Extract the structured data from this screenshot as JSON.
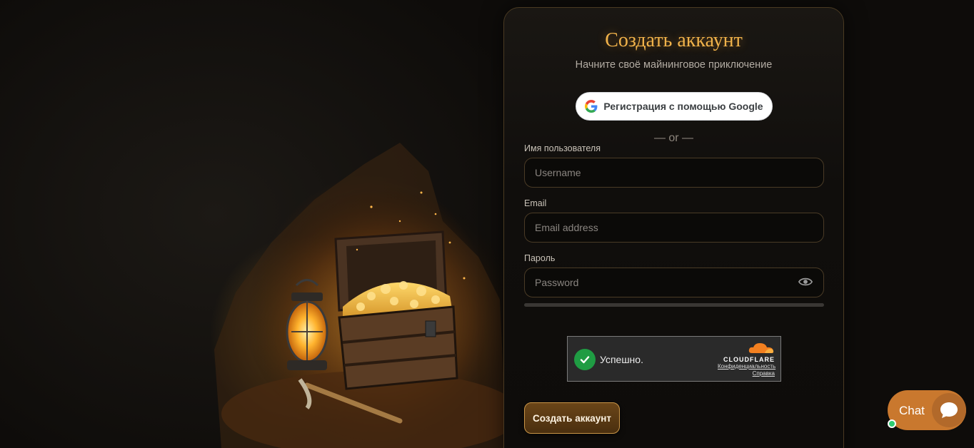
{
  "form": {
    "title": "Создать аккаунт",
    "subtitle": "Начните своё майнинговое приключение",
    "google_label": "Регистрация с помощью Google",
    "divider": "— or —",
    "username_label": "Имя пользователя",
    "username_placeholder": "Username",
    "email_label": "Email",
    "email_placeholder": "Email address",
    "password_label": "Пароль",
    "password_placeholder": "Password",
    "password_strength": 0,
    "submit_label": "Создать аккаунт"
  },
  "captcha": {
    "status": "Успешно.",
    "provider": "CLOUDFLARE",
    "privacy_link": "Конфиденциальность",
    "help_link": "Справка"
  },
  "chat": {
    "label": "Chat",
    "online": true
  },
  "colors": {
    "accent": "#f0b24a",
    "button_bg": "#5a3a14",
    "chat_bg": "#c9782e",
    "success": "#1f9c43"
  },
  "icons": {
    "google": "google-icon",
    "eye": "eye-icon",
    "check": "check-icon",
    "cloudflare": "cloudflare-icon",
    "chat": "chat-bubble-icon"
  }
}
